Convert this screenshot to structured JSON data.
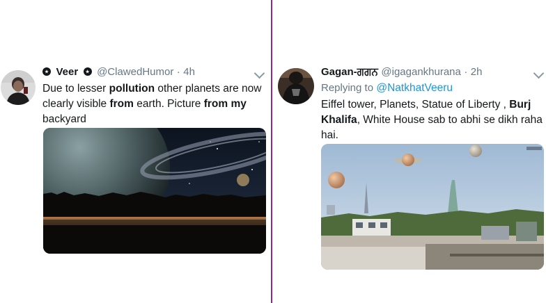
{
  "left_tweet": {
    "display_name": "Veer",
    "handle": "@ClawedHumor",
    "separator": "·",
    "time": "4h",
    "text": {
      "p1": "Due to lesser ",
      "b1": "pollution",
      "p2": " other planets are now clearly visible ",
      "b2": "from",
      "p3": " earth. Picture ",
      "b3": "from my",
      "p4": " backyard"
    }
  },
  "right_tweet": {
    "display_name": "Gagan-ਗਗਨ",
    "handle": "@igagankhurana",
    "separator": "·",
    "time": "2h",
    "replying_prefix": "Replying to",
    "replying_to": "@NatkhatVeeru",
    "text": {
      "p1": "Eiffel tower, Planets, Statue of Liberty , ",
      "b1": "Burj Khalifa",
      "p2": ", White House sab to abhi se dikh raha hai."
    }
  },
  "colors": {
    "divider": "#8e2a86",
    "link": "#1b95e0",
    "muted": "#657786"
  }
}
